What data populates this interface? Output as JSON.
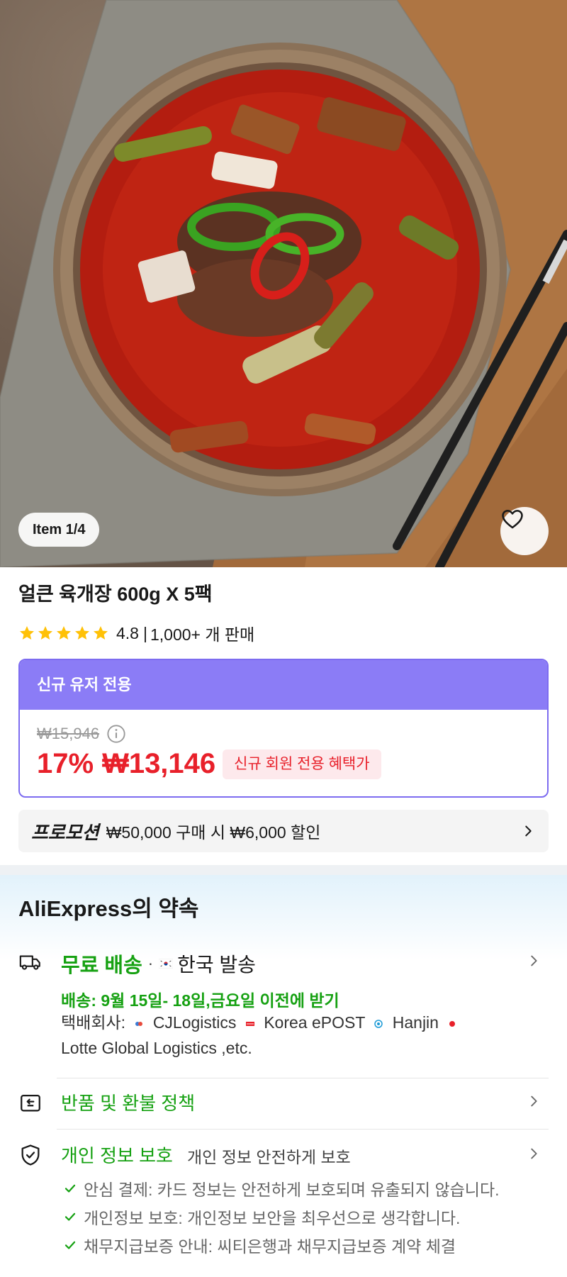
{
  "gallery": {
    "position_label": "Item 1/4",
    "favorite_icon": "heart-outline-icon"
  },
  "product": {
    "title": "얼큰 육개장 600g X 5팩",
    "rating": "4.8",
    "rating_stars": 5,
    "sold_text": "1,000+ 개 판매",
    "rating_separator": "|"
  },
  "new_user_offer": {
    "header": "신규 유저 전용",
    "original_price": "₩15,946",
    "discount": "17%",
    "sale_price": "₩13,146",
    "member_tag": "신규 회원 전용 혜택가"
  },
  "promotion": {
    "label": "프로모션",
    "text": "₩50,000 구매 시 ₩6,000 할인"
  },
  "promise": {
    "title": "AliExpress의 약속",
    "shipping": {
      "free_label": "무료 배송",
      "separator": "·",
      "origin": "한국 발송",
      "eta": "배송: 9월 15일- 18일,금요일 이전에 받기",
      "carriers_label": "택배회사:",
      "carriers": [
        "CJLogistics",
        "Korea ePOST",
        "Hanjin",
        "Lotte Global Logistics ,etc."
      ]
    },
    "returns": {
      "label": "반품 및 환불 정책"
    },
    "privacy": {
      "label": "개인 정보 보호",
      "description": "개인 정보 안전하게 보호",
      "items": [
        "안심 결제: 카드 정보는 안전하게 보호되며 유출되지 않습니다.",
        "개인정보 보호: 개인정보 보안을 최우선으로 생각합니다.",
        "채무지급보증 안내: 씨티은행과 채무지급보증 계약 체결"
      ]
    }
  },
  "colors": {
    "accent_green": "#16a112",
    "price_red": "#e8202a",
    "offer_purple": "#8b7cf6",
    "star_yellow": "#ffc107"
  }
}
